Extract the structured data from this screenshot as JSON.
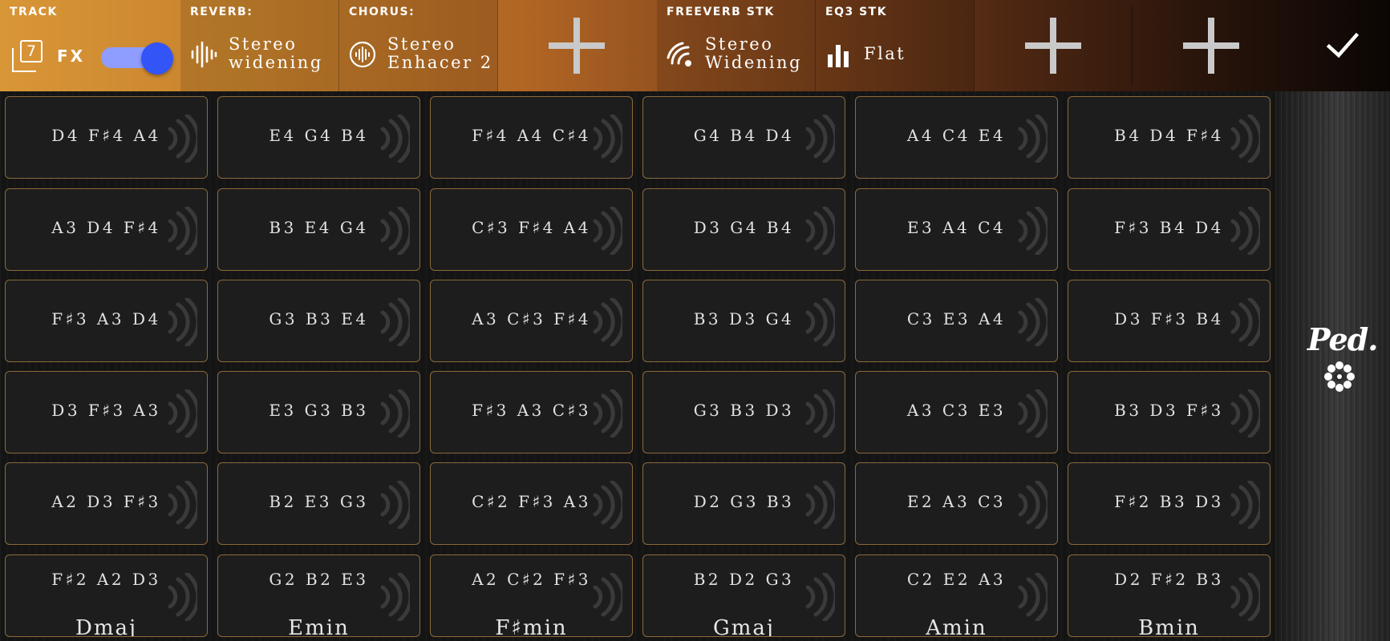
{
  "fx_bar": {
    "track": {
      "heading": "TRACK",
      "count": "7",
      "fx_label": "FX",
      "toggle_on": true,
      "toggle_color": "#3354f7"
    },
    "slots": [
      {
        "heading": "REVERB:",
        "name": "Stereo\nwidening",
        "icon": "waveform-icon"
      },
      {
        "heading": "CHORUS:",
        "name": "Stereo\nEnhacer 2",
        "icon": "circle-waveform-icon"
      },
      {
        "heading": "FREEVERB STK",
        "name": "Stereo\nWidening",
        "icon": "signal-waves-icon"
      },
      {
        "heading": "EQ3 STK",
        "name": "Flat",
        "icon": "bar-eq-icon"
      }
    ],
    "add_slots": 3,
    "confirm_icon": "checkmark-icon"
  },
  "pads": [
    {
      "notes": "D4 F♯4 A4"
    },
    {
      "notes": "E4 G4 B4"
    },
    {
      "notes": "F♯4 A4 C♯4"
    },
    {
      "notes": "G4 B4 D4"
    },
    {
      "notes": "A4 C4 E4"
    },
    {
      "notes": "B4 D4 F♯4"
    },
    {
      "notes": "A3 D4 F♯4"
    },
    {
      "notes": "B3 E4 G4"
    },
    {
      "notes": "C♯3 F♯4 A4"
    },
    {
      "notes": "D3 G4 B4"
    },
    {
      "notes": "E3 A4 C4"
    },
    {
      "notes": "F♯3 B4 D4"
    },
    {
      "notes": "F♯3 A3 D4"
    },
    {
      "notes": "G3 B3 E4"
    },
    {
      "notes": "A3 C♯3 F♯4"
    },
    {
      "notes": "B3 D3 G4"
    },
    {
      "notes": "C3 E3 A4"
    },
    {
      "notes": "D3 F♯3 B4"
    },
    {
      "notes": "D3 F♯3 A3"
    },
    {
      "notes": "E3 G3 B3"
    },
    {
      "notes": "F♯3 A3 C♯3"
    },
    {
      "notes": "G3 B3 D3"
    },
    {
      "notes": "A3 C3 E3"
    },
    {
      "notes": "B3 D3 F♯3"
    },
    {
      "notes": "A2 D3 F♯3"
    },
    {
      "notes": "B2 E3 G3"
    },
    {
      "notes": "C♯2 F♯3 A3"
    },
    {
      "notes": "D2 G3 B3"
    },
    {
      "notes": "E2 A3 C3"
    },
    {
      "notes": "F♯2 B3 D3"
    },
    {
      "notes": "F♯2 A2 D3",
      "chord": "Dmaj"
    },
    {
      "notes": "G2 B2 E3",
      "chord": "Emin"
    },
    {
      "notes": "A2 C♯2 F♯3",
      "chord": "F♯min"
    },
    {
      "notes": "B2 D2 G3",
      "chord": "Gmaj"
    },
    {
      "notes": "C2 E2 A3",
      "chord": "Amin"
    },
    {
      "notes": "D2 F♯2 B3",
      "chord": "Bmin"
    }
  ],
  "side": {
    "pedal_label": "Ped.",
    "pedal_icon": "pedal-release-flower-icon"
  },
  "colors": {
    "pad_border": "#8a6a3c",
    "pad_bg": "#1d1d1d",
    "bar_start": "#d99637",
    "bar_end": "#0b0604"
  }
}
